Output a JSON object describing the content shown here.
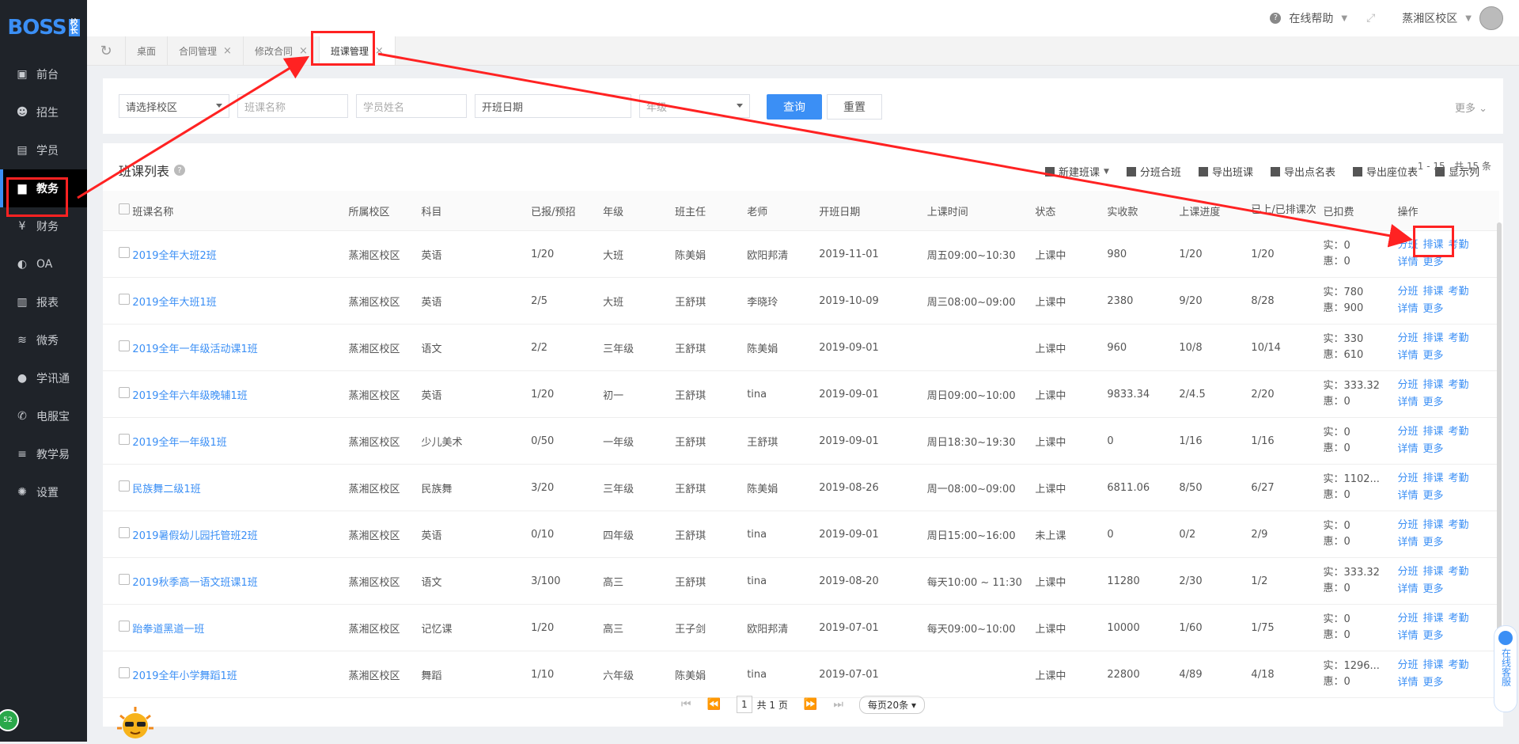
{
  "logo": {
    "text": "BOSS",
    "mark": "校长"
  },
  "sidebar": {
    "items": [
      {
        "label": "前台",
        "icon": "calendar-icon"
      },
      {
        "label": "招生",
        "icon": "user-plus-icon"
      },
      {
        "label": "学员",
        "icon": "id-card-icon"
      },
      {
        "label": "教务",
        "icon": "book-icon"
      },
      {
        "label": "财务",
        "icon": "yen-icon"
      },
      {
        "label": "OA",
        "icon": "toggle-icon"
      },
      {
        "label": "报表",
        "icon": "bar-chart-icon"
      },
      {
        "label": "微秀",
        "icon": "wave-icon"
      },
      {
        "label": "学讯通",
        "icon": "location-icon"
      },
      {
        "label": "电服宝",
        "icon": "phone-icon"
      },
      {
        "label": "教学易",
        "icon": "layers-icon"
      },
      {
        "label": "设置",
        "icon": "gear-icon"
      }
    ],
    "active": "教务"
  },
  "header": {
    "help": "在线帮助",
    "campus": "蒸湘区校区"
  },
  "tabs": [
    {
      "label": "桌面"
    },
    {
      "label": "合同管理"
    },
    {
      "label": "修改合同"
    },
    {
      "label": "班课管理"
    }
  ],
  "filters": {
    "campus_placeholder": "请选择校区",
    "class_name_placeholder": "班课名称",
    "student_name_placeholder": "学员姓名",
    "start_date_placeholder": "开班日期",
    "grade_placeholder": "年级",
    "query_label": "查询",
    "reset_label": "重置",
    "more_label": "更多"
  },
  "list": {
    "title": "班课列表",
    "toolbar": [
      "新建班课",
      "分班合班",
      "导出班课",
      "导出点名表",
      "导出座位表",
      "显示列"
    ],
    "columns": [
      "班课名称",
      "所属校区",
      "科目",
      "已报/预招",
      "年级",
      "班主任",
      "老师",
      "开班日期",
      "上课时间",
      "状态",
      "实收款",
      "上课进度",
      "已上/已排课次",
      "已扣费",
      "操作"
    ],
    "rows": [
      {
        "name": "2019全年大班2班",
        "campus": "蒸湘区校区",
        "subject": "英语",
        "enrolled": "1/20",
        "grade": "大班",
        "head": "陈美娟",
        "teacher": "欧阳邦清",
        "date": "2019-11-01",
        "time": "周五09:00~10:30",
        "status": "上课中",
        "income": "980",
        "progress": "1/20",
        "sessions": "1/20",
        "fee_real": "实：0",
        "fee_disc": "惠：0"
      },
      {
        "name": "2019全年大班1班",
        "campus": "蒸湘区校区",
        "subject": "英语",
        "enrolled": "2/5",
        "grade": "大班",
        "head": "王舒琪",
        "teacher": "李晓玲",
        "date": "2019-10-09",
        "time": "周三08:00~09:00",
        "status": "上课中",
        "income": "2380",
        "progress": "9/20",
        "sessions": "8/28",
        "fee_real": "实：780",
        "fee_disc": "惠：900"
      },
      {
        "name": "2019全年一年级活动课1班",
        "campus": "蒸湘区校区",
        "subject": "语文",
        "enrolled": "2/2",
        "grade": "三年级",
        "head": "王舒琪",
        "teacher": "陈美娟",
        "date": "2019-09-01",
        "time": "",
        "status": "上课中",
        "income": "960",
        "progress": "10/8",
        "sessions": "10/14",
        "fee_real": "实：330",
        "fee_disc": "惠：610"
      },
      {
        "name": "2019全年六年级晚辅1班",
        "campus": "蒸湘区校区",
        "subject": "英语",
        "enrolled": "1/20",
        "grade": "初一",
        "head": "王舒琪",
        "teacher": "tina",
        "date": "2019-09-01",
        "time": "周日09:00~10:00",
        "status": "上课中",
        "income": "9833.34",
        "progress": "2/4.5",
        "sessions": "2/20",
        "fee_real": "实：333.32",
        "fee_disc": "惠：0"
      },
      {
        "name": "2019全年一年级1班",
        "campus": "蒸湘区校区",
        "subject": "少儿美术",
        "enrolled": "0/50",
        "grade": "一年级",
        "head": "王舒琪",
        "teacher": "王舒琪",
        "date": "2019-09-01",
        "time": "周日18:30~19:30",
        "status": "上课中",
        "income": "0",
        "progress": "1/16",
        "sessions": "1/16",
        "fee_real": "实：0",
        "fee_disc": "惠：0"
      },
      {
        "name": "民族舞二级1班",
        "campus": "蒸湘区校区",
        "subject": "民族舞",
        "enrolled": "3/20",
        "grade": "三年级",
        "head": "王舒琪",
        "teacher": "陈美娟",
        "date": "2019-08-26",
        "time": "周一08:00~09:00",
        "status": "上课中",
        "income": "6811.06",
        "progress": "8/50",
        "sessions": "6/27",
        "fee_real": "实：1102...",
        "fee_disc": "惠：0"
      },
      {
        "name": "2019暑假幼儿园托管班2班",
        "campus": "蒸湘区校区",
        "subject": "英语",
        "enrolled": "0/10",
        "grade": "四年级",
        "head": "王舒琪",
        "teacher": "tina",
        "date": "2019-09-01",
        "time": "周日15:00~16:00",
        "status": "未上课",
        "income": "0",
        "progress": "0/2",
        "sessions": "2/9",
        "fee_real": "实：0",
        "fee_disc": "惠：0"
      },
      {
        "name": "2019秋季高一语文班课1班",
        "campus": "蒸湘区校区",
        "subject": "语文",
        "enrolled": "3/100",
        "grade": "高三",
        "head": "王舒琪",
        "teacher": "tina",
        "date": "2019-08-20",
        "time": "每天10:00 ~ 11:30",
        "status": "上课中",
        "income": "11280",
        "progress": "2/30",
        "sessions": "1/2",
        "fee_real": "实：333.32",
        "fee_disc": "惠：0"
      },
      {
        "name": "跆拳道黑道一班",
        "campus": "蒸湘区校区",
        "subject": "记忆课",
        "enrolled": "1/20",
        "grade": "高三",
        "head": "王子剑",
        "teacher": "欧阳邦清",
        "date": "2019-07-01",
        "time": "每天09:00~10:00",
        "status": "上课中",
        "income": "10000",
        "progress": "1/60",
        "sessions": "1/75",
        "fee_real": "实：0",
        "fee_disc": "惠：0"
      },
      {
        "name": "2019全年小学舞蹈1班",
        "campus": "蒸湘区校区",
        "subject": "舞蹈",
        "enrolled": "1/10",
        "grade": "六年级",
        "head": "陈美娟",
        "teacher": "tina",
        "date": "2019-07-01",
        "time": "",
        "status": "上课中",
        "income": "22800",
        "progress": "4/89",
        "sessions": "4/18",
        "fee_real": "实：1296...",
        "fee_disc": "惠：0"
      }
    ],
    "ops": [
      "分班",
      "排课",
      "考勤",
      "详情",
      "更多"
    ]
  },
  "pager": {
    "page": "1",
    "total_pages": "共 1 页",
    "page_size": "每页20条",
    "range": "1 - 15",
    "total": "共 15 条"
  },
  "customer_service": "在线客服",
  "badge": "52",
  "colors": {
    "accent": "#3b8ff5",
    "sidebar": "#1f2329",
    "annotation": "#ff2222"
  }
}
